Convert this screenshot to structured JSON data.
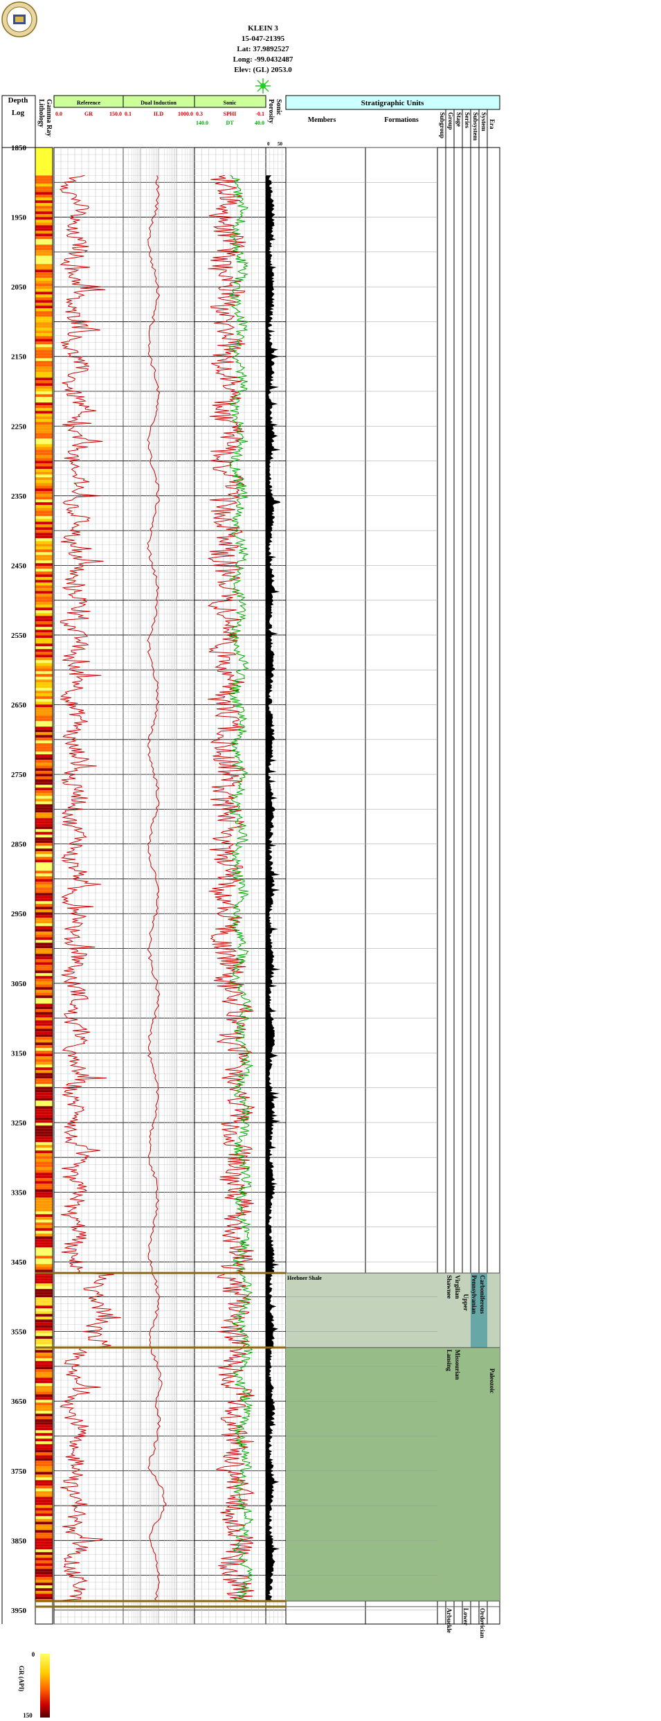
{
  "header": {
    "well_name": "KLEIN 3",
    "api": "15-047-21395",
    "lat": "Lat: 37.9892527",
    "long": "Long: -99.0432487",
    "elev": "Elev: (GL) 2053.0"
  },
  "track_headers": {
    "depth": "Depth",
    "log": "Log",
    "lithology": "Lithology",
    "gamma_ray": "Gamma Ray",
    "reference": "Reference",
    "gr_curve": "GR",
    "gr_min": "0.0",
    "gr_max": "150.0",
    "dual_induction": "Dual Induction",
    "ild_curve": "ILD",
    "ild_min": "0.1",
    "ild_max": "1000.0",
    "sonic": "Sonic",
    "sphi_curve": "SPHI",
    "sphi_min": "0.3",
    "sphi_max": "-0.1",
    "dt_curve": "DT",
    "dt_min": "140.0",
    "dt_max": "40.0",
    "porosity": "Porosity",
    "sonic_short": "Sonic",
    "por_min": "0",
    "por_max": "50",
    "strat_units": "Stratigraphic Units",
    "members": "Members",
    "formations": "Formations",
    "subgroup": "Subgroup",
    "group": "Group",
    "stage": "Stage",
    "series": "Series",
    "subsystem": "Subsystem",
    "system": "System",
    "era": "Era"
  },
  "colors": {
    "gr": "#cc0000",
    "ild": "#cc0000",
    "sphi": "#cc0000",
    "dt": "#00aa00",
    "porosity_fill": "#000000",
    "header_bg": "#ccff99",
    "strat_header_bg": "#ccffff",
    "zone1": "#c3d3bb",
    "zone2": "#98bc88",
    "penn_box": "#67a7a6",
    "top_line": "#8b6914"
  },
  "chart_data": {
    "type": "line",
    "title": "",
    "ylabel": "Depth",
    "depth_range": [
      1850,
      3970
    ],
    "depth_ticks": [
      "1850",
      "1950",
      "2050",
      "2150",
      "2250",
      "2350",
      "2450",
      "2550",
      "2650",
      "2750",
      "2850",
      "2950",
      "3050",
      "3150",
      "3250",
      "3350",
      "3450",
      "3550",
      "3650",
      "3750",
      "3850",
      "3950"
    ],
    "curve_start_depth": 1890,
    "curve_end_depth": 3938,
    "series": [
      {
        "name": "GR",
        "xlim": [
          0,
          150
        ],
        "style": "jagged"
      },
      {
        "name": "ILD",
        "xlim": [
          0.1,
          1000
        ],
        "scale": "log",
        "style": "smooth"
      },
      {
        "name": "SPHI",
        "xlim": [
          0.3,
          -0.1
        ],
        "style": "jagged"
      },
      {
        "name": "DT",
        "xlim": [
          140,
          40
        ],
        "style": "jagged"
      },
      {
        "name": "Porosity Sonic",
        "xlim": [
          0,
          50
        ],
        "style": "fill"
      }
    ],
    "formation_tops": [
      {
        "name": "Heebner Shale",
        "depth": 3466
      },
      {
        "name": "",
        "depth": 3573
      },
      {
        "name": "",
        "depth": 3937
      },
      {
        "name": "",
        "depth": 3945
      }
    ],
    "strat_zones": [
      {
        "member": "Heebner Shale",
        "subgroup": "",
        "group": "Shawnee",
        "stage": "Virgilian",
        "series": "Upper",
        "subsystem": "Pennsylvanian",
        "system": "Carboniferous",
        "top": 3466,
        "bottom": 3573
      },
      {
        "member": "",
        "subgroup": "",
        "group": "Lansing",
        "stage": "Missourian",
        "series": "",
        "subsystem": "",
        "system": "",
        "top": 3573,
        "bottom": 3937
      }
    ],
    "era_label": "Paleozoic",
    "bottom_labels": {
      "group": "Arbuckle",
      "series": "Lower",
      "system": "Ordovician"
    }
  },
  "legend": {
    "title": "GR (API)",
    "min": "0",
    "max": "150"
  }
}
